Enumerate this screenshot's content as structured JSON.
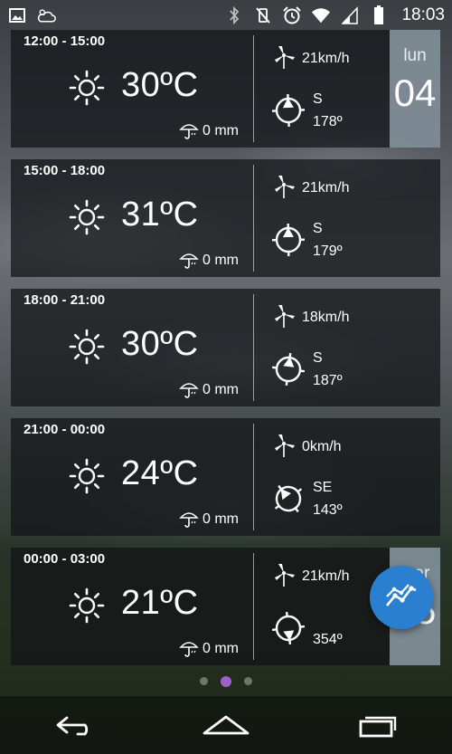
{
  "status_bar": {
    "time": "18:03",
    "left_icons": [
      "image-icon",
      "weather-cloud-icon"
    ],
    "right_icons": [
      "bluetooth-icon",
      "vibrate-off-icon",
      "alarm-icon",
      "wifi-icon",
      "signal-icon",
      "battery-icon"
    ]
  },
  "forecast": [
    {
      "time_range": "12:00 - 15:00",
      "temperature": "30ºC",
      "rain": "0 mm",
      "wind_speed": "21km/h",
      "direction": "S",
      "degrees": "178º"
    },
    {
      "time_range": "15:00 - 18:00",
      "temperature": "31ºC",
      "rain": "0 mm",
      "wind_speed": "21km/h",
      "direction": "S",
      "degrees": "179º"
    },
    {
      "time_range": "18:00 - 21:00",
      "temperature": "30ºC",
      "rain": "0 mm",
      "wind_speed": "18km/h",
      "direction": "S",
      "degrees": "187º"
    },
    {
      "time_range": "21:00 - 00:00",
      "temperature": "24ºC",
      "rain": "0 mm",
      "wind_speed": "0km/h",
      "direction": "SE",
      "degrees": "143º"
    },
    {
      "time_range": "00:00 - 03:00",
      "temperature": "21ºC",
      "rain": "0 mm",
      "wind_speed": "21km/h",
      "direction": "",
      "degrees": "354º"
    }
  ],
  "day_tabs": [
    {
      "day": "lun",
      "number": "04"
    },
    {
      "day": "mar",
      "number": "05"
    }
  ],
  "pager": {
    "pages": 3,
    "active_index": 1
  },
  "colors": {
    "fab": "#2a7fd0",
    "pager_active": "#a15fc9",
    "day_tab": "#8c9ba5",
    "card_bg": "#121418"
  },
  "nav": [
    "back-icon",
    "home-icon",
    "recents-icon"
  ]
}
